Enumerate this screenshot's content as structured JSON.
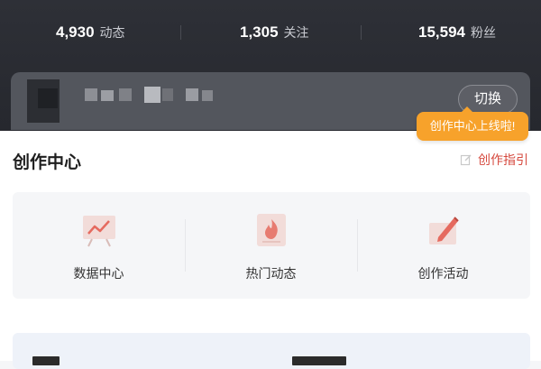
{
  "stats": [
    {
      "value": "4,930",
      "label": "动态"
    },
    {
      "value": "1,305",
      "label": "关注"
    },
    {
      "value": "15,594",
      "label": "粉丝"
    }
  ],
  "account": {
    "switch_label": "切换",
    "tooltip": "创作中心上线啦!"
  },
  "creation": {
    "title": "创作中心",
    "guide_label": "创作指引",
    "tools": [
      {
        "label": "数据中心",
        "icon": "data-chart-icon"
      },
      {
        "label": "热门动态",
        "icon": "hot-fire-icon"
      },
      {
        "label": "创作活动",
        "icon": "pencil-board-icon"
      }
    ]
  },
  "colors": {
    "accent_red": "#d64a3f",
    "tooltip_orange": "#f7a22b",
    "dark_header": "#2e3037"
  }
}
